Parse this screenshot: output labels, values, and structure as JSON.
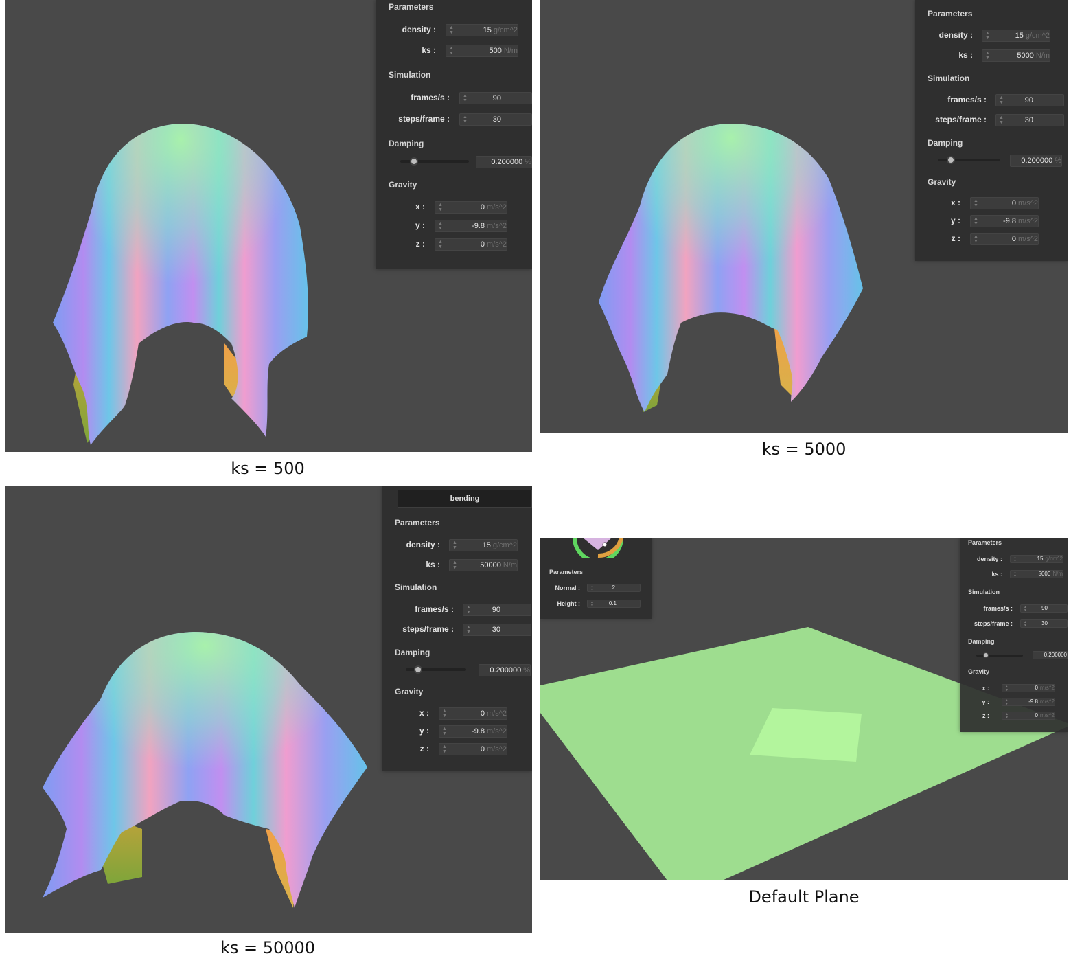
{
  "panels": [
    {
      "caption": "ks = 500",
      "sections": {
        "parameters": "Parameters",
        "simulation": "Simulation",
        "damping": "Damping",
        "gravity": "Gravity"
      },
      "labels": {
        "density": "density :",
        "ks": "ks :",
        "fps": "frames/s :",
        "steps": "steps/frame :",
        "gx": "x :",
        "gy": "y :",
        "gz": "z :"
      },
      "values": {
        "density": "15",
        "ks": "500",
        "fps": "90",
        "steps": "30",
        "damping": "0.200000",
        "gx": "0",
        "gy": "-9.8",
        "gz": "0"
      },
      "units": {
        "density": "g/cm^2",
        "ks": "N/m",
        "damping": "%",
        "gravity": "m/s^2"
      },
      "damping_slider_fraction": 0.2
    },
    {
      "caption": "ks = 5000",
      "sections": {
        "parameters": "Parameters",
        "simulation": "Simulation",
        "damping": "Damping",
        "gravity": "Gravity"
      },
      "labels": {
        "density": "density :",
        "ks": "ks :",
        "fps": "frames/s :",
        "steps": "steps/frame :",
        "gx": "x :",
        "gy": "y :",
        "gz": "z :"
      },
      "values": {
        "density": "15",
        "ks": "5000",
        "fps": "90",
        "steps": "30",
        "damping": "0.200000",
        "gx": "0",
        "gy": "-9.8",
        "gz": "0"
      },
      "units": {
        "density": "g/cm^2",
        "ks": "N/m",
        "damping": "%",
        "gravity": "m/s^2"
      },
      "damping_slider_fraction": 0.2
    },
    {
      "caption": "ks = 50000",
      "button": "bending",
      "sections": {
        "parameters": "Parameters",
        "simulation": "Simulation",
        "damping": "Damping",
        "gravity": "Gravity"
      },
      "labels": {
        "density": "density :",
        "ks": "ks :",
        "fps": "frames/s :",
        "steps": "steps/frame :",
        "gx": "x :",
        "gy": "y :",
        "gz": "z :"
      },
      "values": {
        "density": "15",
        "ks": "50000",
        "fps": "90",
        "steps": "30",
        "damping": "0.200000",
        "gx": "0",
        "gy": "-9.8",
        "gz": "0"
      },
      "units": {
        "density": "g/cm^2",
        "ks": "N/m",
        "damping": "%",
        "gravity": "m/s^2"
      },
      "damping_slider_fraction": 0.2
    },
    {
      "caption": "Default Plane",
      "left_panel": {
        "parameters": "Parameters",
        "normal_label": "Normal :",
        "normal_value": "2",
        "height_label": "Height :",
        "height_value": "0.1"
      },
      "sections": {
        "parameters": "Parameters",
        "simulation": "Simulation",
        "damping": "Damping",
        "gravity": "Gravity"
      },
      "labels": {
        "density": "density :",
        "ks": "ks :",
        "fps": "frames/s :",
        "steps": "steps/frame :",
        "gx": "x :",
        "gy": "y :",
        "gz": "z :"
      },
      "values": {
        "density": "15",
        "ks": "5000",
        "fps": "90",
        "steps": "30",
        "damping": "0.200000",
        "gx": "0",
        "gy": "-9.8",
        "gz": "0"
      },
      "units": {
        "density": "g/cm^2",
        "ks": "N/m",
        "damping": "%",
        "gravity": "m/s^2"
      },
      "damping_slider_fraction": 0.2
    }
  ],
  "colors": {
    "viewport": "#494949",
    "panel": "#2f2f2f",
    "plane": "#9edd8f",
    "plane_center": "#b3f59d"
  }
}
